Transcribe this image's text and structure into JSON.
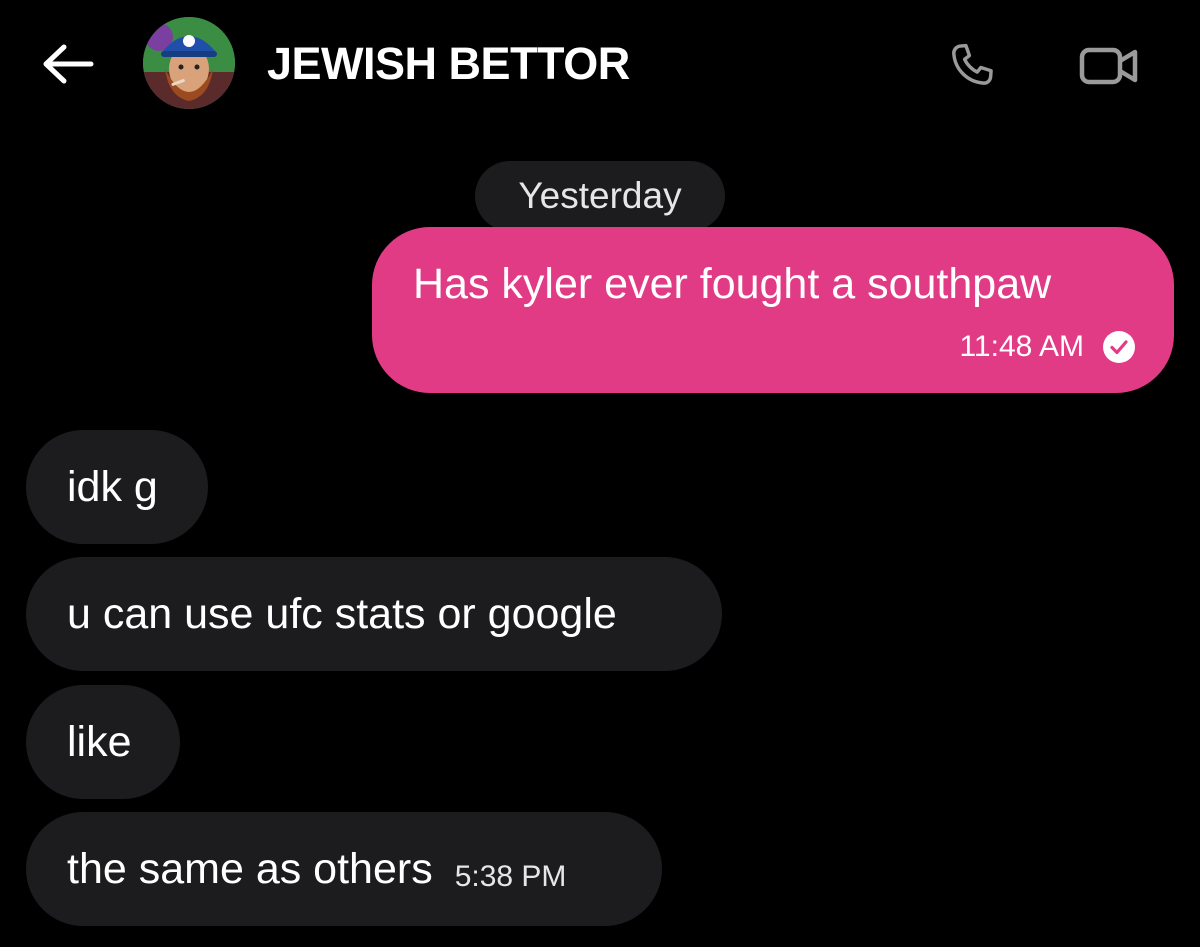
{
  "header": {
    "back_icon": "arrow-left-icon",
    "contact_name": "JEWISH BETTOR",
    "avatar_icon": "profile-avatar",
    "call_icon": "phone-icon",
    "video_icon": "video-camera-icon"
  },
  "conversation": {
    "date_separator": "Yesterday",
    "outgoing": [
      {
        "text": "Has kyler ever fought a southpaw",
        "time": "11:48 AM",
        "status_icon": "read-check-icon"
      }
    ],
    "incoming": [
      {
        "text": "idk g"
      },
      {
        "text": "u can use ufc stats or google"
      },
      {
        "text": "like"
      },
      {
        "text": "the same as others",
        "time": "5:38 PM"
      }
    ]
  },
  "colors": {
    "background": "#000000",
    "outgoing_bubble": "#e23b86",
    "incoming_bubble": "#1c1c1e",
    "icon_gray": "#9a9a9a"
  }
}
